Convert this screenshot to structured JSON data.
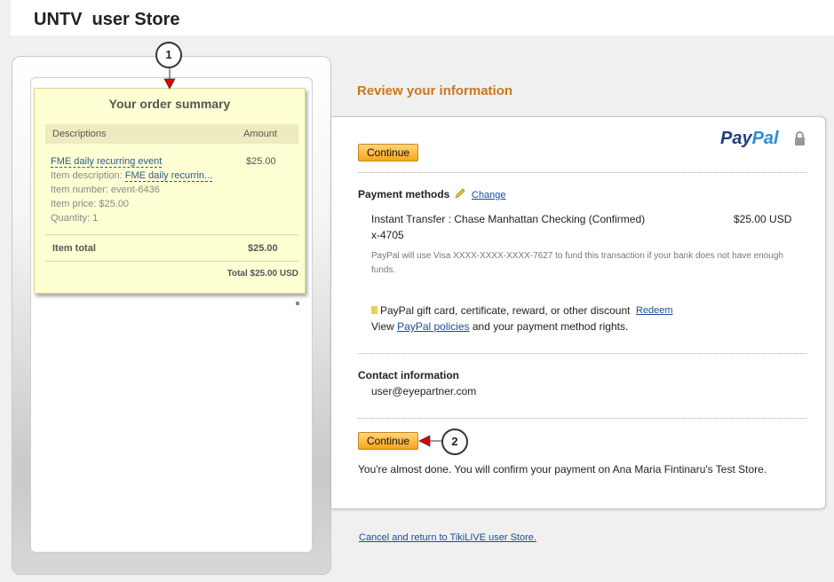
{
  "header": {
    "store_title": "UNTV  user Store"
  },
  "order_summary": {
    "title": "Your order summary",
    "col_descriptions": "Descriptions",
    "col_amount": "Amount",
    "item_name": "FME daily recurring event",
    "item_description_label": "Item description:",
    "item_description_value": "FME daily recurrin...",
    "item_number": "Item number: event-6436",
    "item_price": "Item price: $25.00",
    "quantity": "Quantity: 1",
    "item_amount": "$25.00",
    "item_total_label": "Item total",
    "item_total_value": "$25.00",
    "grand_total": "Total $25.00 USD"
  },
  "callouts": {
    "one": "1",
    "two": "2"
  },
  "review": {
    "title": "Review your information",
    "continue_top": "Continue",
    "paypal_logo_a": "Pay",
    "paypal_logo_b": "Pal",
    "payment_methods_label": "Payment methods",
    "change_link": "Change",
    "payment_desc": "Instant Transfer : Chase Manhattan Checking (Confirmed)",
    "payment_amount": "$25.00 USD",
    "account_suffix": "x-4705",
    "backup_note": "PayPal will use Visa XXXX-XXXX-XXXX-7627 to fund this transaction if your bank does not have enough funds.",
    "gift_text": "PayPal gift card, certificate, reward, or other discount",
    "redeem_link": "Redeem",
    "policy_prefix": "View ",
    "policy_link": "PayPal policies",
    "policy_suffix": " and your payment method rights.",
    "contact_label": "Contact information",
    "contact_email": "user@eyepartner.com",
    "continue_bottom": "Continue",
    "done_text": "You're almost done. You will confirm your payment on Ana Maria Fintinaru's Test Store.",
    "cancel_link": "Cancel and return to TikiLIVE user Store."
  },
  "colors": {
    "accent_title": "#c8781e",
    "summary_bg": "#ffffd4",
    "button": "#f7a41c",
    "link": "#1a4c9c",
    "callout_arrow": "#dd0000"
  },
  "icons": [
    "pencil-icon",
    "lock-icon",
    "arrow-icon"
  ]
}
